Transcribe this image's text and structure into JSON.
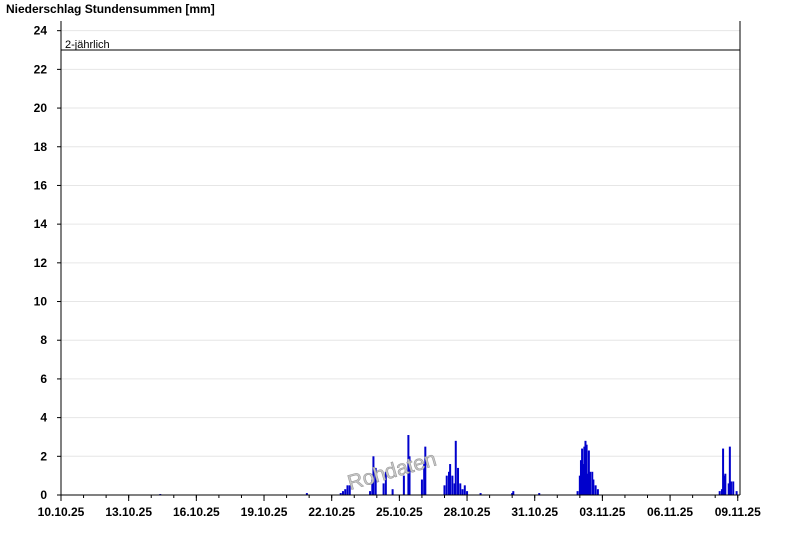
{
  "chart_data": {
    "type": "bar",
    "title": "Niederschlag Stundensummen [mm]",
    "xlabel": "",
    "ylabel": "",
    "ylim": [
      0,
      24.5
    ],
    "y_ticks": [
      0,
      2,
      4,
      6,
      8,
      10,
      12,
      14,
      16,
      18,
      20,
      22,
      24
    ],
    "x_tick_labels": [
      "10.10.25",
      "13.10.25",
      "16.10.25",
      "19.10.25",
      "22.10.25",
      "25.10.25",
      "28.10.25",
      "31.10.25",
      "03.11.25",
      "06.11.25",
      "09.11.25"
    ],
    "x_tick_days": [
      0,
      3,
      6,
      9,
      12,
      15,
      18,
      21,
      24,
      27,
      30
    ],
    "x_range_days": [
      0,
      30.1
    ],
    "grid": true,
    "threshold": {
      "label": "2-jährlich",
      "value": 23
    },
    "watermark": "Rohdaten",
    "bar_color": "#0000cc",
    "series": [
      {
        "values": [
          {
            "t": 4.4,
            "v": 0.05
          },
          {
            "t": 10.9,
            "v": 0.1
          },
          {
            "t": 12.4,
            "v": 0.1
          },
          {
            "t": 12.5,
            "v": 0.2
          },
          {
            "t": 12.6,
            "v": 0.3
          },
          {
            "t": 12.7,
            "v": 0.5
          },
          {
            "t": 12.8,
            "v": 0.5
          },
          {
            "t": 13.7,
            "v": 0.2
          },
          {
            "t": 13.8,
            "v": 0.8
          },
          {
            "t": 13.85,
            "v": 2.0
          },
          {
            "t": 13.95,
            "v": 1.4
          },
          {
            "t": 14.3,
            "v": 0.6
          },
          {
            "t": 14.4,
            "v": 1.2
          },
          {
            "t": 14.7,
            "v": 0.3
          },
          {
            "t": 15.2,
            "v": 1.0
          },
          {
            "t": 15.4,
            "v": 3.1
          },
          {
            "t": 15.45,
            "v": 2.0
          },
          {
            "t": 16.0,
            "v": 0.8
          },
          {
            "t": 16.1,
            "v": 1.6
          },
          {
            "t": 16.15,
            "v": 2.5
          },
          {
            "t": 17.0,
            "v": 0.5
          },
          {
            "t": 17.1,
            "v": 1.0
          },
          {
            "t": 17.2,
            "v": 1.2
          },
          {
            "t": 17.25,
            "v": 1.6
          },
          {
            "t": 17.35,
            "v": 1.0
          },
          {
            "t": 17.45,
            "v": 0.6
          },
          {
            "t": 17.5,
            "v": 2.8
          },
          {
            "t": 17.6,
            "v": 1.4
          },
          {
            "t": 17.7,
            "v": 0.6
          },
          {
            "t": 17.8,
            "v": 0.3
          },
          {
            "t": 17.9,
            "v": 0.5
          },
          {
            "t": 18.0,
            "v": 0.2
          },
          {
            "t": 18.6,
            "v": 0.1
          },
          {
            "t": 20.0,
            "v": 0.1
          },
          {
            "t": 20.05,
            "v": 0.2
          },
          {
            "t": 21.2,
            "v": 0.1
          },
          {
            "t": 22.9,
            "v": 0.2
          },
          {
            "t": 23.0,
            "v": 1.0
          },
          {
            "t": 23.05,
            "v": 1.8
          },
          {
            "t": 23.1,
            "v": 2.4
          },
          {
            "t": 23.15,
            "v": 1.6
          },
          {
            "t": 23.2,
            "v": 2.5
          },
          {
            "t": 23.25,
            "v": 2.8
          },
          {
            "t": 23.3,
            "v": 2.6
          },
          {
            "t": 23.35,
            "v": 1.1
          },
          {
            "t": 23.4,
            "v": 2.3
          },
          {
            "t": 23.45,
            "v": 1.2
          },
          {
            "t": 23.55,
            "v": 1.2
          },
          {
            "t": 23.6,
            "v": 0.8
          },
          {
            "t": 23.7,
            "v": 0.5
          },
          {
            "t": 23.8,
            "v": 0.3
          },
          {
            "t": 29.2,
            "v": 0.2
          },
          {
            "t": 29.3,
            "v": 0.3
          },
          {
            "t": 29.35,
            "v": 2.4
          },
          {
            "t": 29.4,
            "v": 1.0
          },
          {
            "t": 29.45,
            "v": 1.1
          },
          {
            "t": 29.6,
            "v": 0.6
          },
          {
            "t": 29.65,
            "v": 2.5
          },
          {
            "t": 29.7,
            "v": 0.7
          },
          {
            "t": 29.8,
            "v": 0.7
          },
          {
            "t": 29.95,
            "v": 0.2
          }
        ]
      }
    ]
  }
}
